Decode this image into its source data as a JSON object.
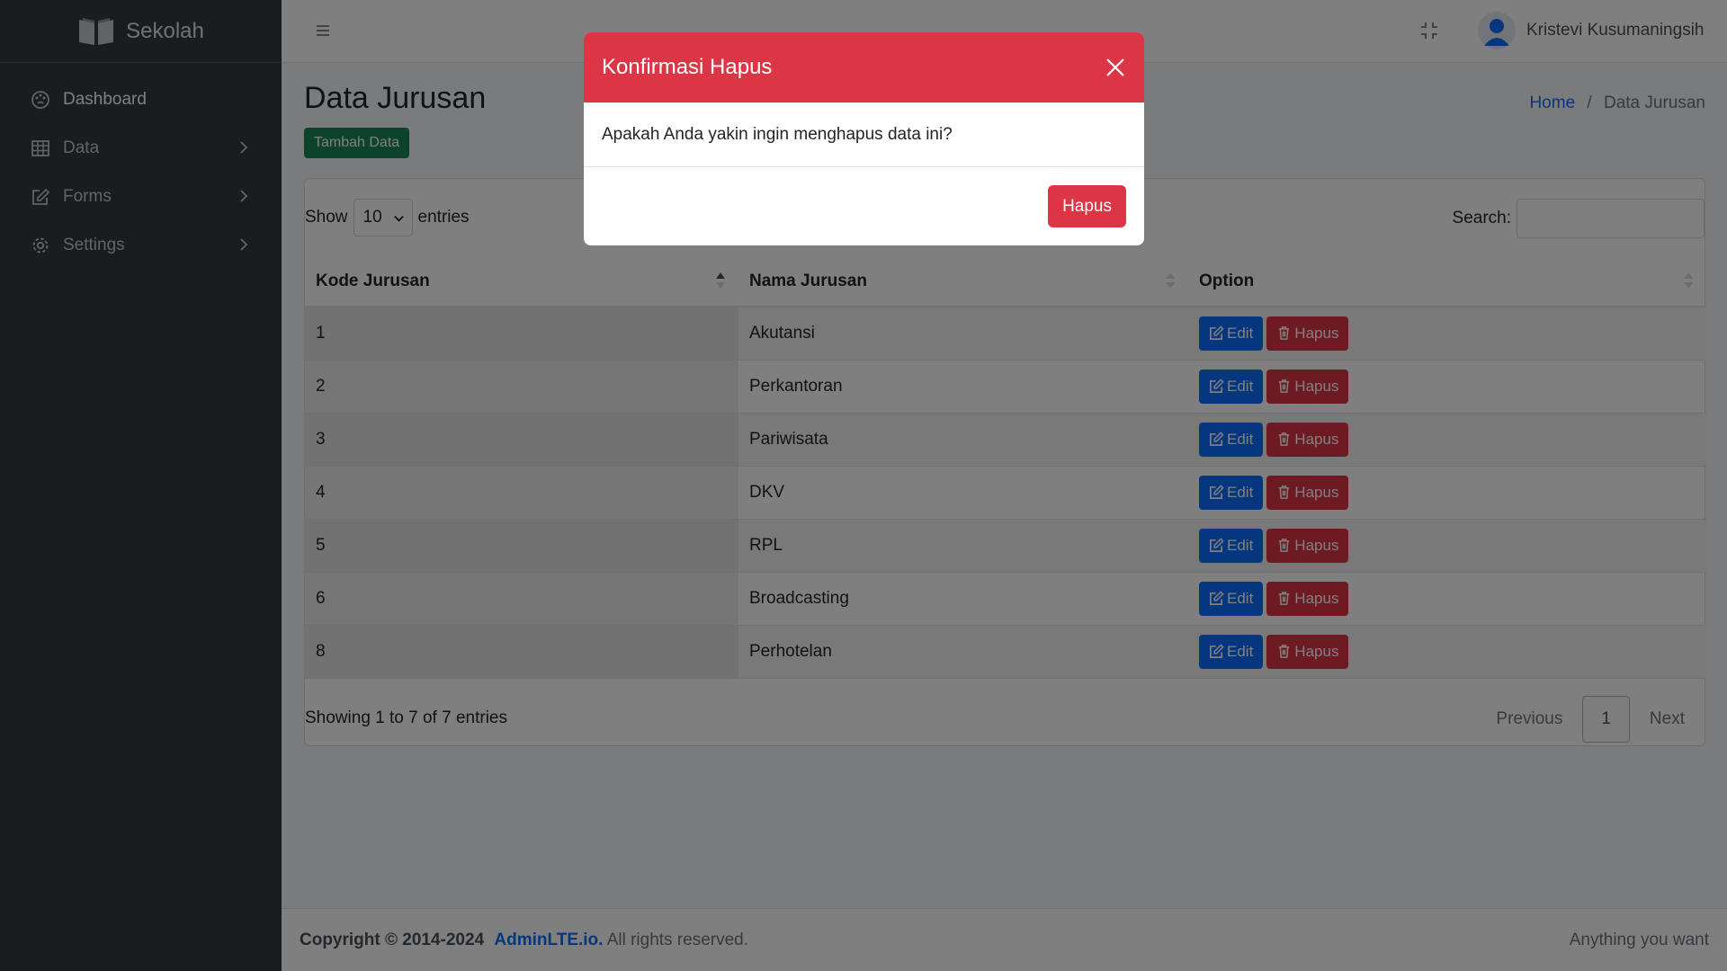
{
  "brand": {
    "name": "Sekolah",
    "icon": "book-open-icon"
  },
  "sidebar": {
    "items": [
      {
        "label": "Dashboard",
        "icon": "palette-icon"
      },
      {
        "label": "Data",
        "icon": "table-icon"
      },
      {
        "label": "Forms",
        "icon": "pencil-square-icon"
      },
      {
        "label": "Settings",
        "icon": "gear-icon"
      }
    ]
  },
  "topbar": {
    "user_name": "Kristevi Kusumaningsih"
  },
  "page": {
    "title": "Data Jurusan",
    "add_button": "Tambah Data",
    "breadcrumb": {
      "home": "Home",
      "separator": "/",
      "current": "Data Jurusan"
    }
  },
  "datatable": {
    "show_label": "Show",
    "entries_value": "10",
    "entries_label": "entries",
    "search_label": "Search:",
    "search_value": "",
    "columns": [
      "Kode Jurusan",
      "Nama Jurusan",
      "Option"
    ],
    "edit_label": "Edit",
    "delete_label": "Hapus",
    "rows": [
      {
        "kode": "1",
        "nama": "Akutansi"
      },
      {
        "kode": "2",
        "nama": "Perkantoran"
      },
      {
        "kode": "3",
        "nama": "Pariwisata"
      },
      {
        "kode": "4",
        "nama": "DKV"
      },
      {
        "kode": "5",
        "nama": "RPL"
      },
      {
        "kode": "6",
        "nama": "Broadcasting"
      },
      {
        "kode": "8",
        "nama": "Perhotelan"
      }
    ],
    "info": "Showing 1 to 7 of 7 entries",
    "pager": {
      "previous": "Previous",
      "current": "1",
      "next": "Next"
    }
  },
  "footer": {
    "copyright": "Copyright © 2014-2024",
    "link": "AdminLTE.io.",
    "rights": "All rights reserved.",
    "right_text": "Anything you want"
  },
  "modal": {
    "title": "Konfirmasi Hapus",
    "message": "Apakah Anda yakin ingin menghapus data ini?",
    "confirm_label": "Hapus"
  },
  "colors": {
    "sidebar_bg": "#343a40",
    "danger": "#dc3545",
    "primary": "#0d6efd",
    "success": "#198754"
  }
}
